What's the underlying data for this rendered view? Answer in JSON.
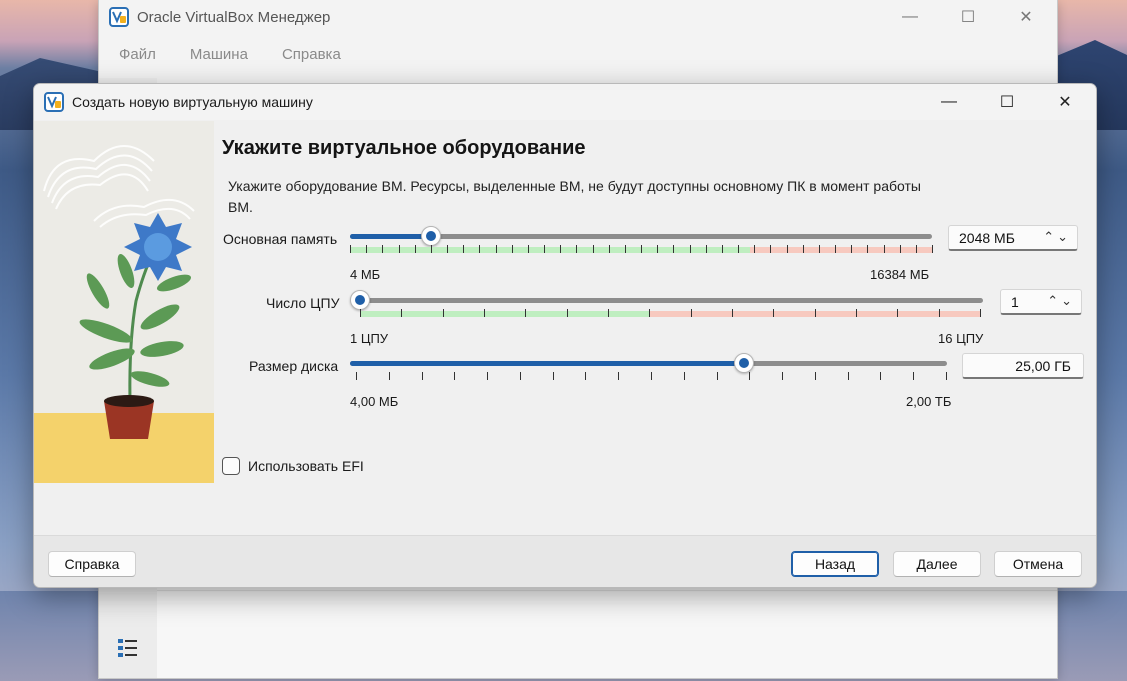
{
  "main_window": {
    "title": "Oracle VirtualBox Менеджер",
    "menu": [
      "Файл",
      "Машина",
      "Справка"
    ]
  },
  "dialog": {
    "title": "Создать новую виртуальную машину",
    "heading": "Укажите виртуальное оборудование",
    "description": "Укажите оборудование ВМ. Ресурсы, выделенные ВМ, не будут доступны основному ПК в момент работы ВМ.",
    "memory": {
      "label": "Основная память",
      "value": "2048 МБ",
      "min_label": "4 МБ",
      "max_label": "16384 МБ",
      "slider_fraction": 0.14
    },
    "cpu": {
      "label": "Число ЦПУ",
      "value": "1",
      "min_label": "1 ЦПУ",
      "max_label": "16 ЦПУ",
      "slider_fraction": 0.0
    },
    "disk": {
      "label": "Размер диска",
      "value": "25,00 ГБ",
      "min_label": "4,00 МБ",
      "max_label": "2,00 ТБ",
      "slider_fraction": 0.66
    },
    "efi_label": "Использовать EFI",
    "efi_checked": false,
    "buttons": {
      "help": "Справка",
      "back": "Назад",
      "next": "Далее",
      "cancel": "Отмена"
    }
  },
  "colors": {
    "accent": "#1f5fa8",
    "safe_zone": "#bfeec0",
    "warning_zone": "#f7c9bf"
  }
}
